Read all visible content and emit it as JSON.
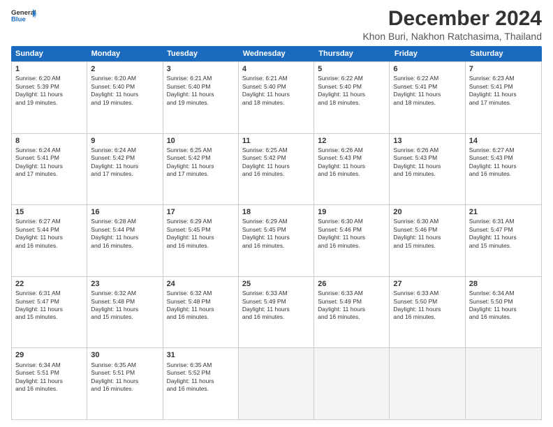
{
  "header": {
    "logo_general": "General",
    "logo_blue": "Blue",
    "month_title": "December 2024",
    "location": "Khon Buri, Nakhon Ratchasima, Thailand"
  },
  "days_of_week": [
    "Sunday",
    "Monday",
    "Tuesday",
    "Wednesday",
    "Thursday",
    "Friday",
    "Saturday"
  ],
  "weeks": [
    [
      {
        "day": 1,
        "info": "Sunrise: 6:20 AM\nSunset: 5:39 PM\nDaylight: 11 hours\nand 19 minutes."
      },
      {
        "day": 2,
        "info": "Sunrise: 6:20 AM\nSunset: 5:40 PM\nDaylight: 11 hours\nand 19 minutes."
      },
      {
        "day": 3,
        "info": "Sunrise: 6:21 AM\nSunset: 5:40 PM\nDaylight: 11 hours\nand 19 minutes."
      },
      {
        "day": 4,
        "info": "Sunrise: 6:21 AM\nSunset: 5:40 PM\nDaylight: 11 hours\nand 18 minutes."
      },
      {
        "day": 5,
        "info": "Sunrise: 6:22 AM\nSunset: 5:40 PM\nDaylight: 11 hours\nand 18 minutes."
      },
      {
        "day": 6,
        "info": "Sunrise: 6:22 AM\nSunset: 5:41 PM\nDaylight: 11 hours\nand 18 minutes."
      },
      {
        "day": 7,
        "info": "Sunrise: 6:23 AM\nSunset: 5:41 PM\nDaylight: 11 hours\nand 17 minutes."
      }
    ],
    [
      {
        "day": 8,
        "info": "Sunrise: 6:24 AM\nSunset: 5:41 PM\nDaylight: 11 hours\nand 17 minutes."
      },
      {
        "day": 9,
        "info": "Sunrise: 6:24 AM\nSunset: 5:42 PM\nDaylight: 11 hours\nand 17 minutes."
      },
      {
        "day": 10,
        "info": "Sunrise: 6:25 AM\nSunset: 5:42 PM\nDaylight: 11 hours\nand 17 minutes."
      },
      {
        "day": 11,
        "info": "Sunrise: 6:25 AM\nSunset: 5:42 PM\nDaylight: 11 hours\nand 16 minutes."
      },
      {
        "day": 12,
        "info": "Sunrise: 6:26 AM\nSunset: 5:43 PM\nDaylight: 11 hours\nand 16 minutes."
      },
      {
        "day": 13,
        "info": "Sunrise: 6:26 AM\nSunset: 5:43 PM\nDaylight: 11 hours\nand 16 minutes."
      },
      {
        "day": 14,
        "info": "Sunrise: 6:27 AM\nSunset: 5:43 PM\nDaylight: 11 hours\nand 16 minutes."
      }
    ],
    [
      {
        "day": 15,
        "info": "Sunrise: 6:27 AM\nSunset: 5:44 PM\nDaylight: 11 hours\nand 16 minutes."
      },
      {
        "day": 16,
        "info": "Sunrise: 6:28 AM\nSunset: 5:44 PM\nDaylight: 11 hours\nand 16 minutes."
      },
      {
        "day": 17,
        "info": "Sunrise: 6:29 AM\nSunset: 5:45 PM\nDaylight: 11 hours\nand 16 minutes."
      },
      {
        "day": 18,
        "info": "Sunrise: 6:29 AM\nSunset: 5:45 PM\nDaylight: 11 hours\nand 16 minutes."
      },
      {
        "day": 19,
        "info": "Sunrise: 6:30 AM\nSunset: 5:46 PM\nDaylight: 11 hours\nand 16 minutes."
      },
      {
        "day": 20,
        "info": "Sunrise: 6:30 AM\nSunset: 5:46 PM\nDaylight: 11 hours\nand 15 minutes."
      },
      {
        "day": 21,
        "info": "Sunrise: 6:31 AM\nSunset: 5:47 PM\nDaylight: 11 hours\nand 15 minutes."
      }
    ],
    [
      {
        "day": 22,
        "info": "Sunrise: 6:31 AM\nSunset: 5:47 PM\nDaylight: 11 hours\nand 15 minutes."
      },
      {
        "day": 23,
        "info": "Sunrise: 6:32 AM\nSunset: 5:48 PM\nDaylight: 11 hours\nand 15 minutes."
      },
      {
        "day": 24,
        "info": "Sunrise: 6:32 AM\nSunset: 5:48 PM\nDaylight: 11 hours\nand 16 minutes."
      },
      {
        "day": 25,
        "info": "Sunrise: 6:33 AM\nSunset: 5:49 PM\nDaylight: 11 hours\nand 16 minutes."
      },
      {
        "day": 26,
        "info": "Sunrise: 6:33 AM\nSunset: 5:49 PM\nDaylight: 11 hours\nand 16 minutes."
      },
      {
        "day": 27,
        "info": "Sunrise: 6:33 AM\nSunset: 5:50 PM\nDaylight: 11 hours\nand 16 minutes."
      },
      {
        "day": 28,
        "info": "Sunrise: 6:34 AM\nSunset: 5:50 PM\nDaylight: 11 hours\nand 16 minutes."
      }
    ],
    [
      {
        "day": 29,
        "info": "Sunrise: 6:34 AM\nSunset: 5:51 PM\nDaylight: 11 hours\nand 16 minutes."
      },
      {
        "day": 30,
        "info": "Sunrise: 6:35 AM\nSunset: 5:51 PM\nDaylight: 11 hours\nand 16 minutes."
      },
      {
        "day": 31,
        "info": "Sunrise: 6:35 AM\nSunset: 5:52 PM\nDaylight: 11 hours\nand 16 minutes."
      },
      {
        "day": null,
        "info": ""
      },
      {
        "day": null,
        "info": ""
      },
      {
        "day": null,
        "info": ""
      },
      {
        "day": null,
        "info": ""
      }
    ]
  ]
}
